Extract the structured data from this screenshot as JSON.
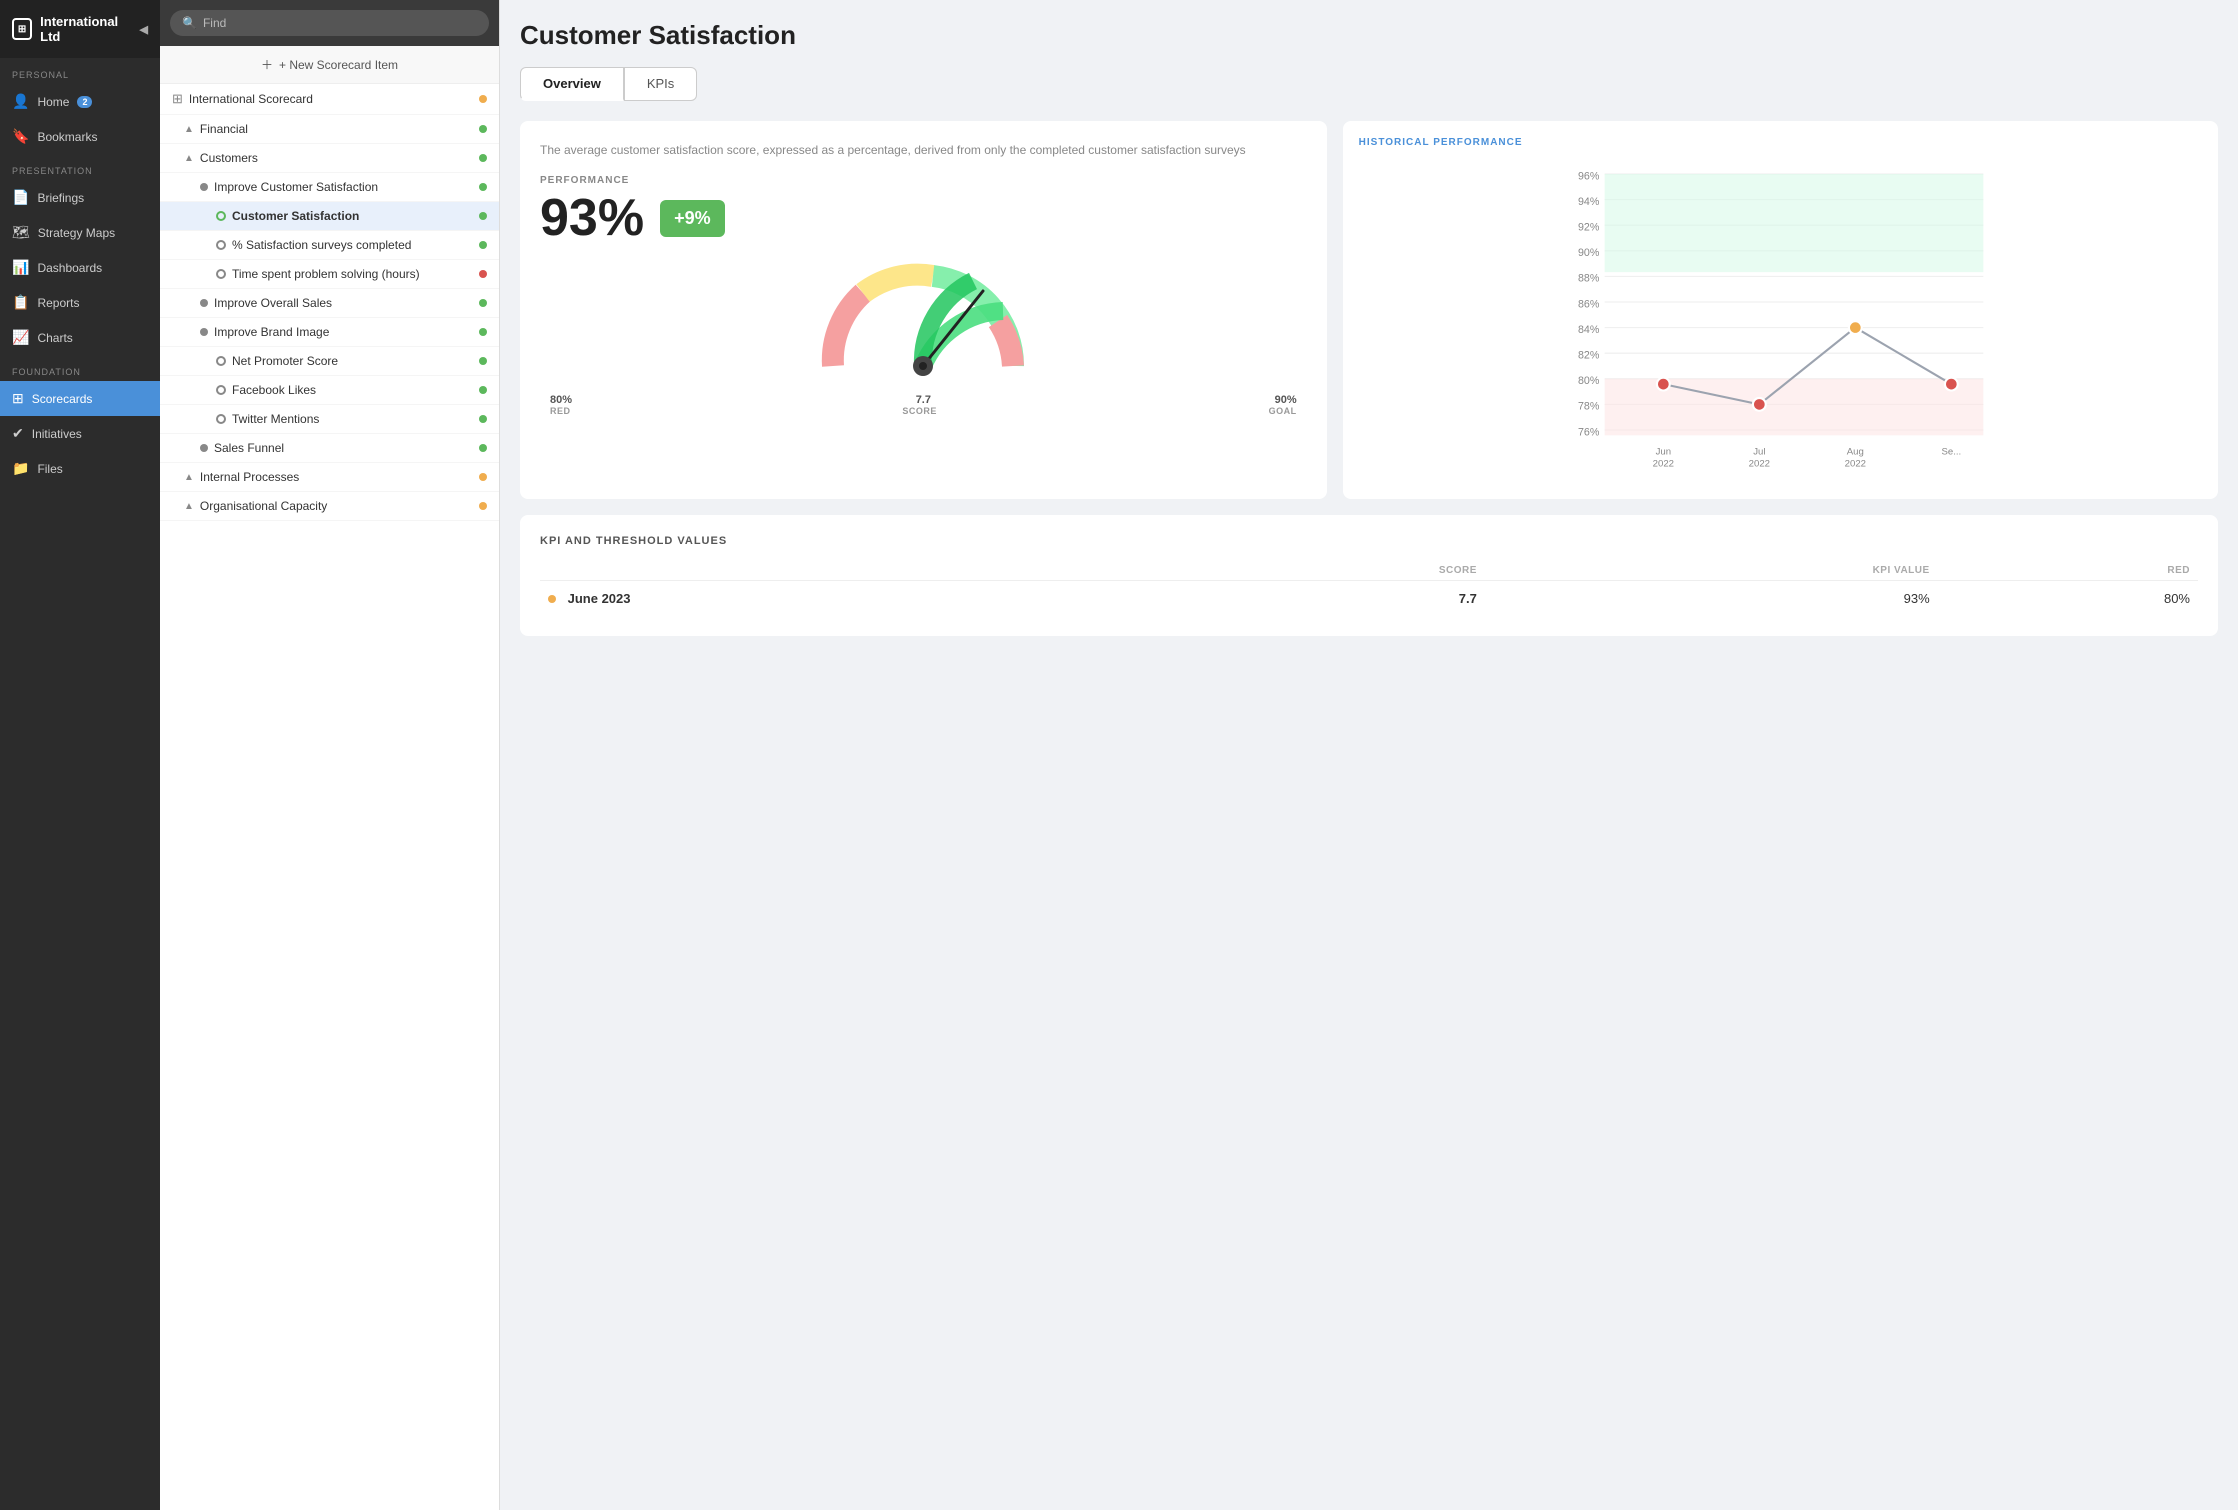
{
  "app": {
    "name": "International Ltd",
    "collapse_icon": "◀"
  },
  "sidebar": {
    "personal_label": "PERSONAL",
    "presentation_label": "PRESENTATION",
    "foundation_label": "FOUNDATION",
    "items": [
      {
        "id": "home",
        "label": "Home",
        "icon": "👤",
        "badge": "2"
      },
      {
        "id": "bookmarks",
        "label": "Bookmarks",
        "icon": "🔖",
        "badge": ""
      },
      {
        "id": "briefings",
        "label": "Briefings",
        "icon": "📄",
        "badge": ""
      },
      {
        "id": "strategy-maps",
        "label": "Strategy Maps",
        "icon": "🗺",
        "badge": ""
      },
      {
        "id": "dashboards",
        "label": "Dashboards",
        "icon": "📊",
        "badge": ""
      },
      {
        "id": "reports",
        "label": "Reports",
        "icon": "📋",
        "badge": ""
      },
      {
        "id": "charts",
        "label": "Charts",
        "icon": "📈",
        "badge": ""
      },
      {
        "id": "scorecards",
        "label": "Scorecards",
        "icon": "⊞",
        "badge": "",
        "active": true
      },
      {
        "id": "initiatives",
        "label": "Initiatives",
        "icon": "✔",
        "badge": ""
      },
      {
        "id": "files",
        "label": "Files",
        "icon": "📁",
        "badge": ""
      }
    ]
  },
  "middle": {
    "search_placeholder": "Find",
    "new_item_label": "+ New Scorecard Item",
    "tree": [
      {
        "id": "intl-scorecard",
        "label": "International Scorecard",
        "indent": 0,
        "type": "scorecard",
        "dot": "yellow"
      },
      {
        "id": "financial",
        "label": "Financial",
        "indent": 1,
        "type": "triangle",
        "dot": "green"
      },
      {
        "id": "customers",
        "label": "Customers",
        "indent": 1,
        "type": "triangle",
        "dot": "green"
      },
      {
        "id": "improve-cust-sat",
        "label": "Improve Customer Satisfaction",
        "indent": 2,
        "type": "circle-filled",
        "dot": "green"
      },
      {
        "id": "customer-satisfaction",
        "label": "Customer Satisfaction",
        "indent": 3,
        "type": "circle-outline-green",
        "dot": "green",
        "selected": true
      },
      {
        "id": "pct-surveys",
        "label": "% Satisfaction surveys completed",
        "indent": 3,
        "type": "circle-outline",
        "dot": "green"
      },
      {
        "id": "time-spent",
        "label": "Time spent problem solving (hours)",
        "indent": 3,
        "type": "circle-outline",
        "dot": "red"
      },
      {
        "id": "improve-overall",
        "label": "Improve Overall Sales",
        "indent": 2,
        "type": "circle-filled",
        "dot": "green"
      },
      {
        "id": "improve-brand",
        "label": "Improve Brand Image",
        "indent": 2,
        "type": "circle-filled",
        "dot": "green"
      },
      {
        "id": "net-promoter",
        "label": "Net Promoter Score",
        "indent": 3,
        "type": "circle-outline",
        "dot": "green"
      },
      {
        "id": "facebook-likes",
        "label": "Facebook Likes",
        "indent": 3,
        "type": "circle-outline",
        "dot": "green"
      },
      {
        "id": "twitter-mentions",
        "label": "Twitter Mentions",
        "indent": 3,
        "type": "circle-outline",
        "dot": "green"
      },
      {
        "id": "sales-funnel",
        "label": "Sales Funnel",
        "indent": 2,
        "type": "circle-filled",
        "dot": "green"
      },
      {
        "id": "internal-processes",
        "label": "Internal Processes",
        "indent": 1,
        "type": "triangle",
        "dot": "yellow"
      },
      {
        "id": "org-capacity",
        "label": "Organisational Capacity",
        "indent": 1,
        "type": "triangle",
        "dot": "yellow"
      }
    ]
  },
  "main": {
    "title": "Customer Satisfaction",
    "tabs": [
      {
        "id": "overview",
        "label": "Overview",
        "active": true
      },
      {
        "id": "kpis",
        "label": "KPIs",
        "active": false
      }
    ],
    "overview": {
      "description": "The average customer satisfaction score, expressed as a percentage, derived from only the completed customer satisfaction surveys",
      "performance_label": "PERFORMANCE",
      "big_value": "93%",
      "change": "+9%",
      "gauge": {
        "red_value": "80%",
        "red_label": "RED",
        "score_value": "7.7",
        "score_label": "SCORE",
        "goal_value": "90%",
        "goal_label": "GOAL"
      }
    },
    "historical": {
      "title": "HISTORICAL PERFORMANCE",
      "y_labels": [
        "96%",
        "94%",
        "92%",
        "90%",
        "88%",
        "86%",
        "84%",
        "82%",
        "80%",
        "78%",
        "76%"
      ],
      "x_labels": [
        "Jun 2022",
        "Jul 2022",
        "Aug 2022",
        "Se..."
      ],
      "data_points": [
        {
          "x": 0,
          "y": 80,
          "color": "#d9534f"
        },
        {
          "x": 1,
          "y": 79,
          "color": "#d9534f"
        },
        {
          "x": 2,
          "y": 86,
          "color": "#f0ad4e"
        },
        {
          "x": 3,
          "y": 80,
          "color": "#d9534f"
        }
      ]
    },
    "kpi_table": {
      "title": "KPI AND THRESHOLD VALUES",
      "columns": [
        "",
        "SCORE",
        "KPI VALUE",
        "RED"
      ],
      "rows": [
        {
          "date": "June 2023",
          "score": "7.7",
          "kpi_value": "93%",
          "red": "80%",
          "dot_color": "yellow"
        }
      ]
    }
  }
}
